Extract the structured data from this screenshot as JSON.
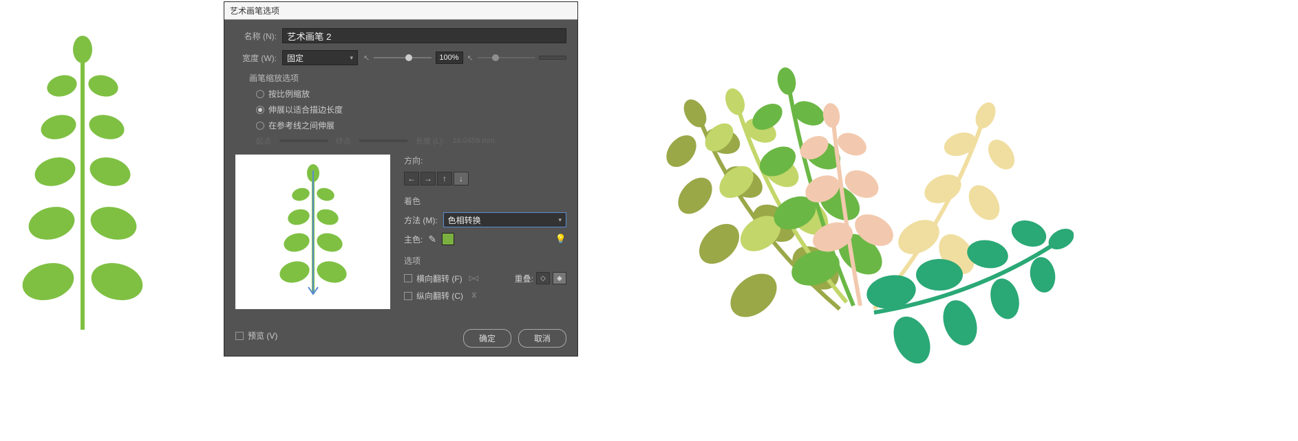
{
  "dialog": {
    "title": "艺术画笔选项",
    "name_label": "名称 (N):",
    "name_value": "艺术画笔 2",
    "width_label": "宽度 (W):",
    "width_mode": "固定",
    "width_value": "100%",
    "scale_section": "画笔缩放选项",
    "scale_options": [
      {
        "label": "按比例缩放",
        "checked": false
      },
      {
        "label": "伸展以适合描边长度",
        "checked": true
      },
      {
        "label": "在参考线之间伸展",
        "checked": false
      }
    ],
    "disabled_start_label": "起点",
    "disabled_end_label": "终点",
    "disabled_length_label": "长度 (L):",
    "disabled_length_value": "16.0459 mm",
    "direction_label": "方向:",
    "colorize_label": "着色",
    "method_label": "方法 (M):",
    "method_value": "色相转换",
    "keycolor_label": "主色:",
    "options_label": "选项",
    "flip_h": "横向翻转 (F)",
    "flip_v": "纵向翻转 (C)",
    "overlap_label": "重叠:",
    "preview_label": "预览 (V)",
    "ok": "确定",
    "cancel": "取消"
  },
  "colors": {
    "plant_green": "#7fc043",
    "olive": "#9aa848",
    "lime": "#c3d66a",
    "peach": "#f2c9ae",
    "cream": "#f0dea0",
    "teal": "#2aa876",
    "bright_green": "#6bb745"
  }
}
